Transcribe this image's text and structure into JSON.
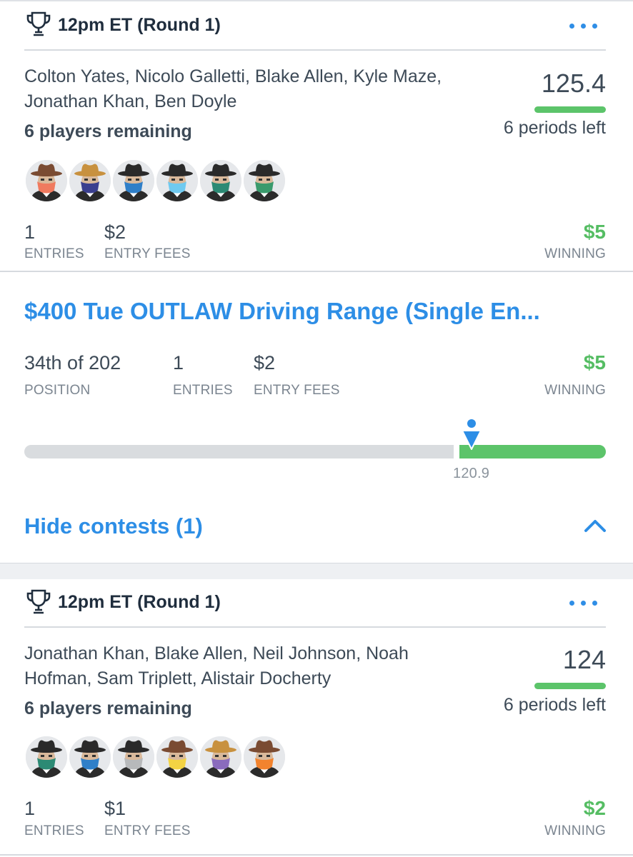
{
  "card1": {
    "title": "12pm ET (Round 1)",
    "names": "Colton Yates, Nicolo Galletti, Blake Allen, Kyle Maze, Jonathan Khan, Ben Doyle",
    "remaining": "6 players remaining",
    "score": "125.4",
    "periods": "6 periods left",
    "avatar_colors": [
      "#f07a5f",
      "#3b3f8f",
      "#2f7fc8",
      "#6fcaf0",
      "#2c8a74",
      "#3a9a6c"
    ],
    "hat_colors": [
      "#7a4b32",
      "#c8913f",
      "#2a2a2a",
      "#2a2a2a",
      "#2a2a2a",
      "#2a2a2a"
    ],
    "entries": "1",
    "entries_label": "ENTRIES",
    "fees": "$2",
    "fees_label": "ENTRY FEES",
    "winning": "$5",
    "winning_label": "WINNING"
  },
  "contest": {
    "name": "$400 Tue OUTLAW Driving Range (Single En...",
    "position": "34th of 202",
    "position_label": "POSITION",
    "entries": "1",
    "entries_label": "ENTRIES",
    "fees": "$2",
    "fees_label": "ENTRY FEES",
    "winning": "$5",
    "winning_label": "WINNING",
    "marker_value": "120.9",
    "marker_fraction": 0.752,
    "hide_label": "Hide contests (1)"
  },
  "card2": {
    "title": "12pm ET (Round 1)",
    "names": "Jonathan Khan, Blake Allen, Neil Johnson, Noah Hofman, Sam Triplett, Alistair Docherty",
    "remaining": "6 players remaining",
    "score": "124",
    "periods": "6 periods left",
    "avatar_colors": [
      "#2c8a74",
      "#2f7fc8",
      "#b7b9bb",
      "#f3d343",
      "#8a6bbd",
      "#f2832e"
    ],
    "hat_colors": [
      "#2a2a2a",
      "#2a2a2a",
      "#2a2a2a",
      "#7a4b32",
      "#c8913f",
      "#7a4b32"
    ],
    "entries": "1",
    "entries_label": "ENTRIES",
    "fees": "$1",
    "fees_label": "ENTRY FEES",
    "winning": "$2",
    "winning_label": "WINNING"
  }
}
